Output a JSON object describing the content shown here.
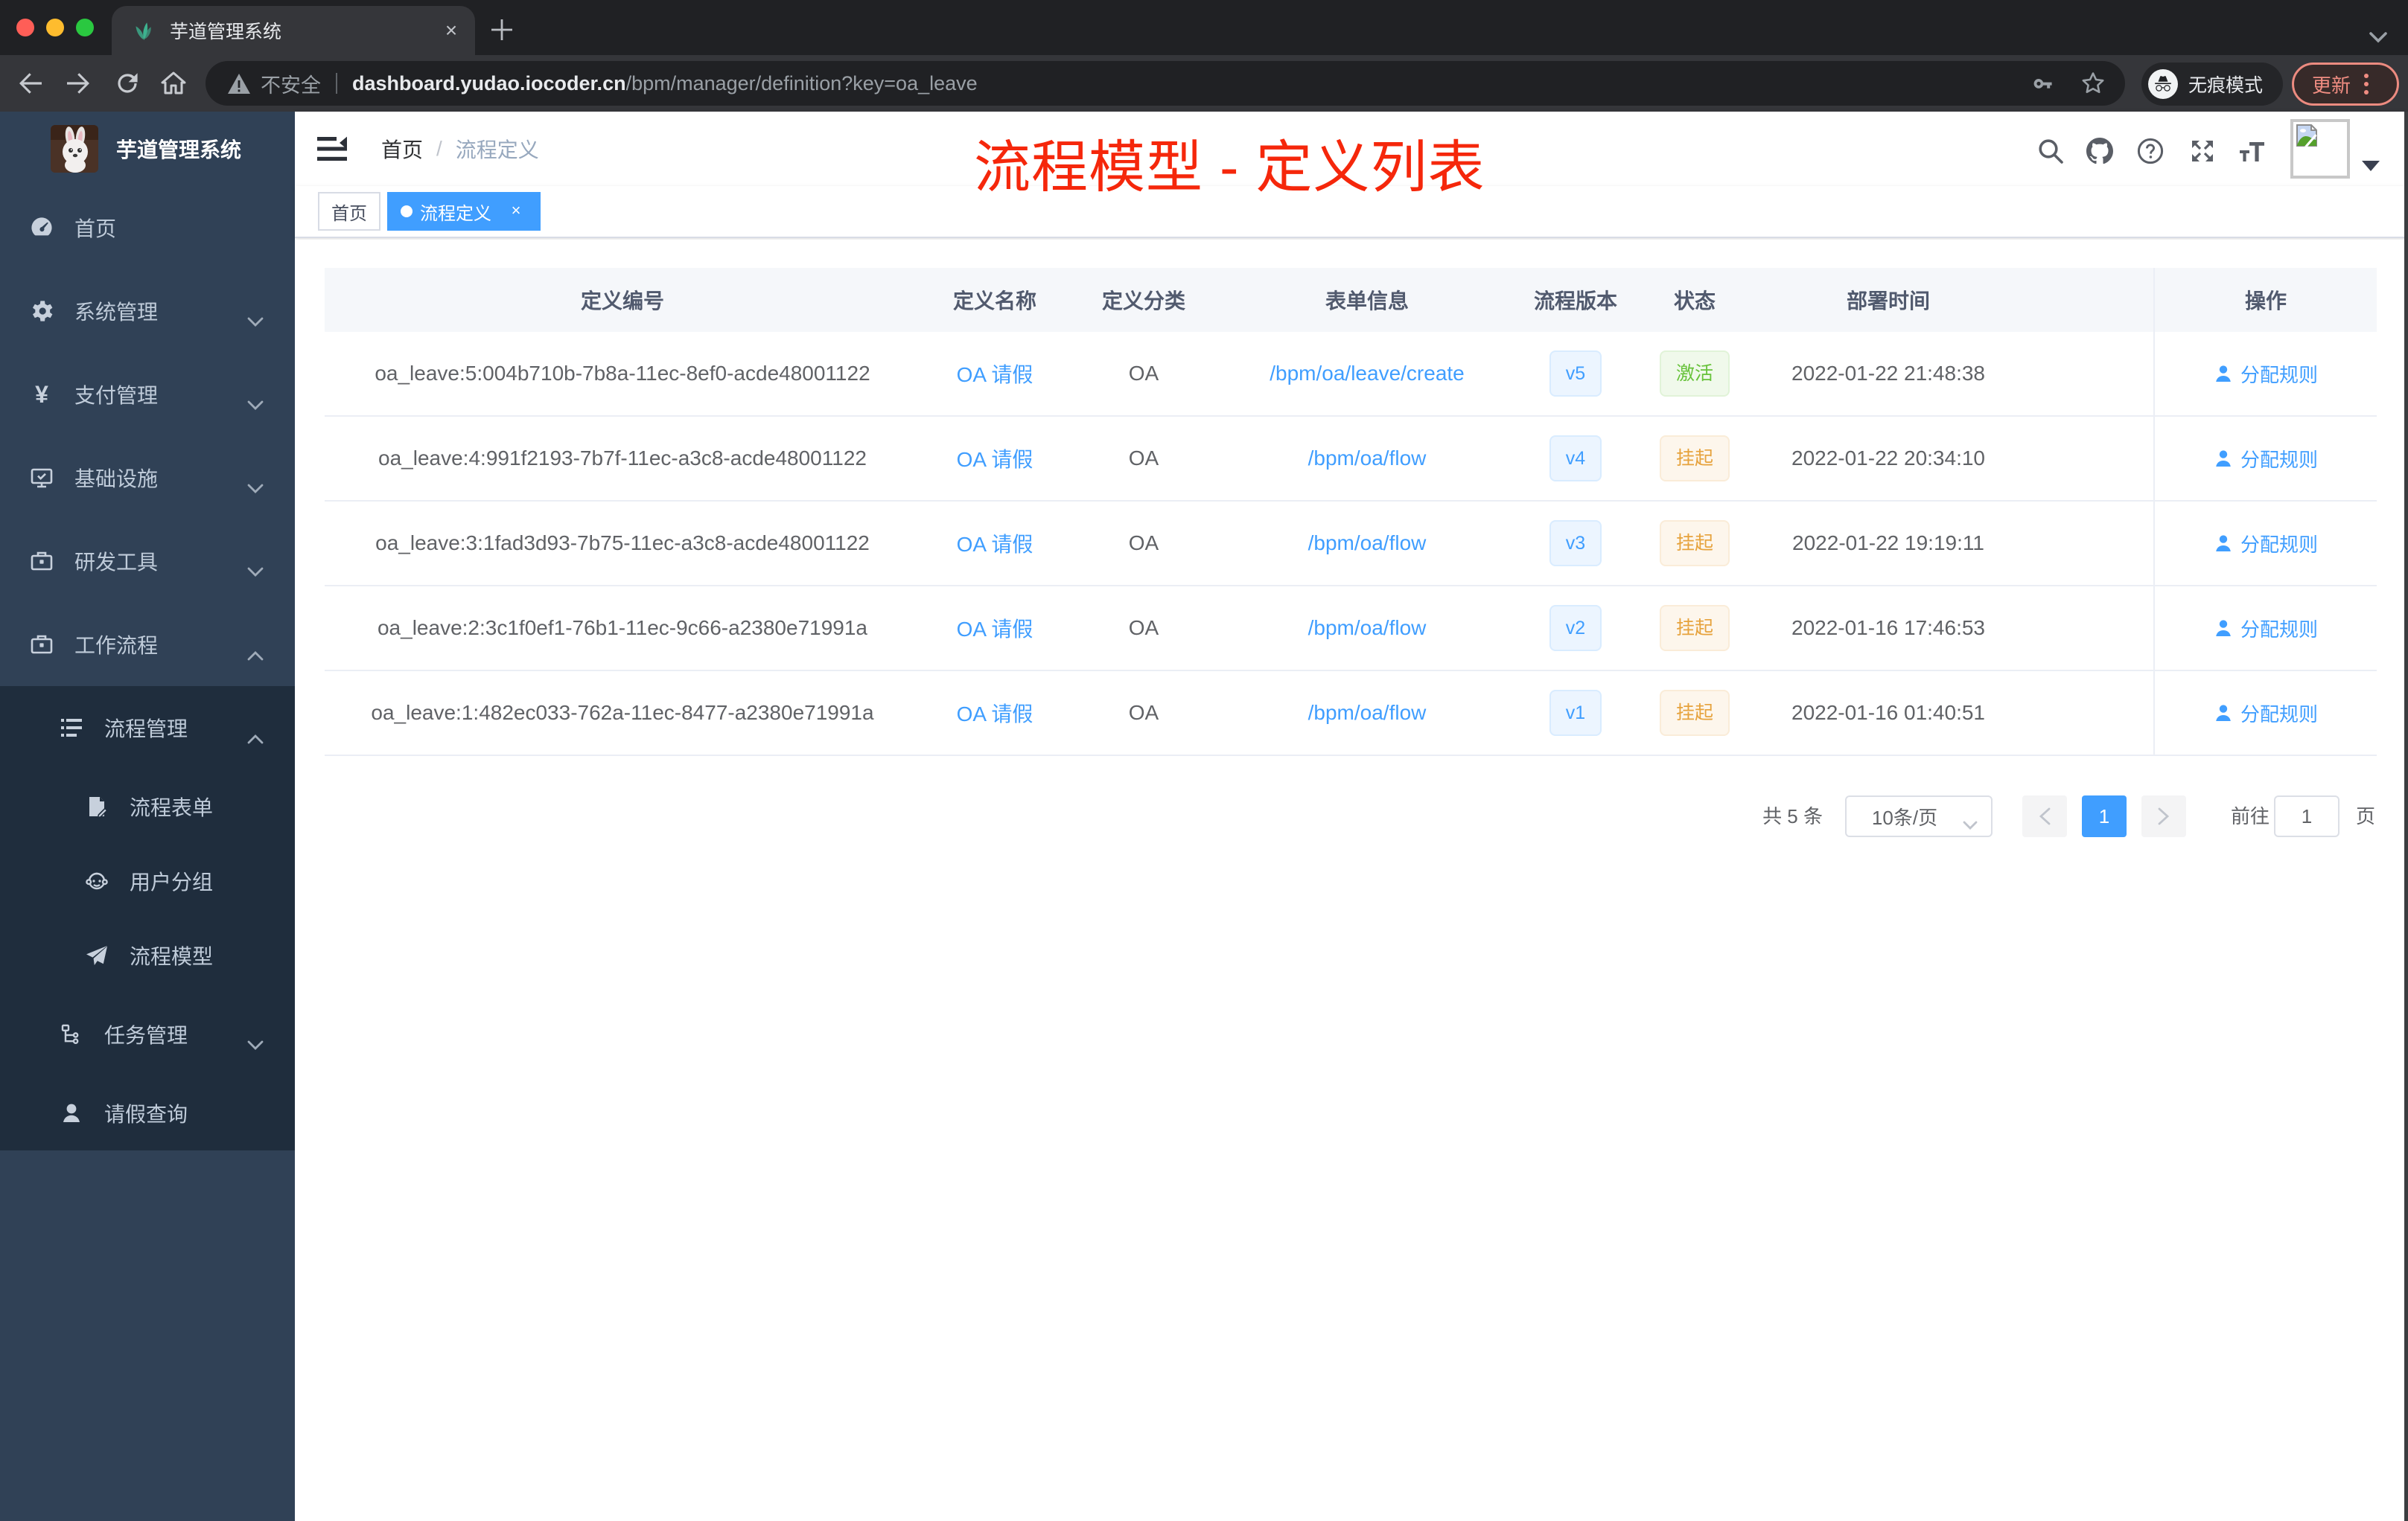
{
  "browser": {
    "tab": {
      "title": "芋道管理系统",
      "close": "×"
    },
    "url": {
      "security_label": "不安全",
      "host": "dashboard.yudao.iocoder.cn",
      "path": "/bpm/manager/definition?key=oa_leave"
    },
    "incognito_label": "无痕模式",
    "update_label": "更新"
  },
  "sidebar": {
    "brand": "芋道管理系统",
    "items": [
      {
        "label": "首页",
        "icon": "dashboard"
      },
      {
        "label": "系统管理",
        "icon": "gear",
        "expandable": true
      },
      {
        "label": "支付管理",
        "icon": "yen",
        "expandable": true
      },
      {
        "label": "基础设施",
        "icon": "monitor",
        "expandable": true
      },
      {
        "label": "研发工具",
        "icon": "toolbox",
        "expandable": true
      },
      {
        "label": "工作流程",
        "icon": "briefcase",
        "expandable": true,
        "expanded": true
      }
    ],
    "workflow_children": {
      "process_mgmt": {
        "label": "流程管理",
        "expanded": true,
        "children": [
          {
            "label": "流程表单"
          },
          {
            "label": "用户分组"
          },
          {
            "label": "流程模型"
          }
        ]
      },
      "task_mgmt": {
        "label": "任务管理"
      },
      "leave_query": {
        "label": "请假查询"
      }
    }
  },
  "navbar": {
    "breadcrumb": {
      "home": "首页",
      "separator": "/",
      "current": "流程定义"
    }
  },
  "tags": {
    "home": {
      "label": "首页"
    },
    "current": {
      "label": "流程定义",
      "close": "×"
    }
  },
  "annotation": "流程模型 - 定义列表",
  "table": {
    "headers": [
      "定义编号",
      "定义名称",
      "定义分类",
      "表单信息",
      "流程版本",
      "状态",
      "部署时间",
      "操作"
    ],
    "rows": [
      {
        "id": "oa_leave:5:004b710b-7b8a-11ec-8ef0-acde48001122",
        "name": "OA 请假",
        "category": "OA",
        "form": "/bpm/oa/leave/create",
        "version": "v5",
        "status": "激活",
        "status_type": "success",
        "deployed": "2022-01-22 21:48:38",
        "action": "分配规则"
      },
      {
        "id": "oa_leave:4:991f2193-7b7f-11ec-a3c8-acde48001122",
        "name": "OA 请假",
        "category": "OA",
        "form": "/bpm/oa/flow",
        "version": "v4",
        "status": "挂起",
        "status_type": "warning",
        "deployed": "2022-01-22 20:34:10",
        "action": "分配规则"
      },
      {
        "id": "oa_leave:3:1fad3d93-7b75-11ec-a3c8-acde48001122",
        "name": "OA 请假",
        "category": "OA",
        "form": "/bpm/oa/flow",
        "version": "v3",
        "status": "挂起",
        "status_type": "warning",
        "deployed": "2022-01-22 19:19:11",
        "action": "分配规则"
      },
      {
        "id": "oa_leave:2:3c1f0ef1-76b1-11ec-9c66-a2380e71991a",
        "name": "OA 请假",
        "category": "OA",
        "form": "/bpm/oa/flow",
        "version": "v2",
        "status": "挂起",
        "status_type": "warning",
        "deployed": "2022-01-16 17:46:53",
        "action": "分配规则"
      },
      {
        "id": "oa_leave:1:482ec033-762a-11ec-8477-a2380e71991a",
        "name": "OA 请假",
        "category": "OA",
        "form": "/bpm/oa/flow",
        "version": "v1",
        "status": "挂起",
        "status_type": "warning",
        "deployed": "2022-01-16 01:40:51",
        "action": "分配规则"
      }
    ]
  },
  "pagination": {
    "total": "共 5 条",
    "page_size": "10条/页",
    "current_page": "1",
    "goto_label": "前往",
    "goto_value": "1",
    "page_unit": "页"
  }
}
